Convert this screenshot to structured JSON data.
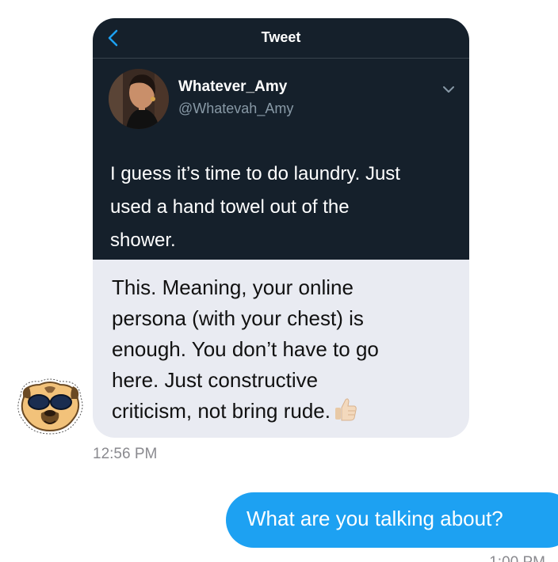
{
  "incoming_message": {
    "tweet": {
      "header_title": "Tweet",
      "author_name": "Whatever_Amy",
      "author_handle": "@Whatevah_Amy",
      "text_lines": [
        "I guess it’s time to do laundry. Just",
        "used a hand towel out of the",
        "shower."
      ]
    },
    "text_lines": [
      "This. Meaning, your online",
      "persona (with your chest) is",
      "enough. You don’t have to go",
      "here. Just constructive",
      "criticism, not bring rude."
    ],
    "emoji": "thumbs-up",
    "timestamp": "12:56 PM"
  },
  "outgoing_message": {
    "text": "What are you talking about?",
    "timestamp": "1:00 PM"
  },
  "colors": {
    "tweet_background": "#15202b",
    "incoming_bubble": "#e9ebf2",
    "outgoing_bubble": "#1da1f2",
    "link_blue": "#1da1f2",
    "secondary_text": "#8899a6"
  },
  "icons": {
    "back": "chevron-left-icon",
    "more": "chevron-down-icon",
    "sender_avatar": "pug-sunglasses-avatar"
  }
}
